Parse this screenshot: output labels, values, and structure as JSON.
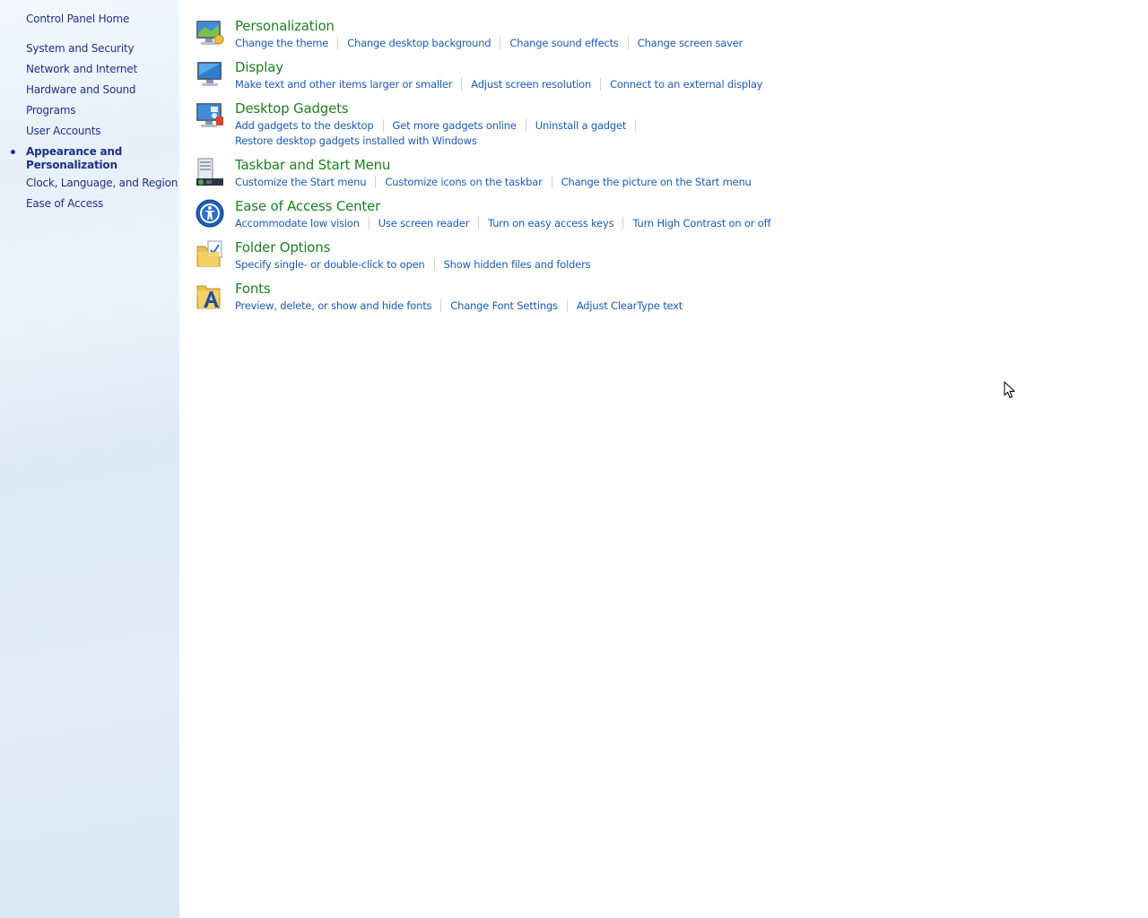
{
  "sidebar": {
    "home_label": "Control Panel Home",
    "items": [
      {
        "label": "System and Security"
      },
      {
        "label": "Network and Internet"
      },
      {
        "label": "Hardware and Sound"
      },
      {
        "label": "Programs"
      },
      {
        "label": "User Accounts"
      },
      {
        "label": "Appearance and Personalization",
        "active": true
      },
      {
        "label": "Clock, Language, and Region"
      },
      {
        "label": "Ease of Access"
      }
    ]
  },
  "categories": [
    {
      "title": "Personalization",
      "icon": "personalization-icon",
      "links": [
        "Change the theme",
        "Change desktop background",
        "Change sound effects",
        "Change screen saver"
      ]
    },
    {
      "title": "Display",
      "icon": "display-icon",
      "links": [
        "Make text and other items larger or smaller",
        "Adjust screen resolution",
        "Connect to an external display"
      ]
    },
    {
      "title": "Desktop Gadgets",
      "icon": "desktop-gadgets-icon",
      "links": [
        "Add gadgets to the desktop",
        "Get more gadgets online",
        "Uninstall a gadget",
        "Restore desktop gadgets installed with Windows"
      ]
    },
    {
      "title": "Taskbar and Start Menu",
      "icon": "taskbar-icon",
      "links": [
        "Customize the Start menu",
        "Customize icons on the taskbar",
        "Change the picture on the Start menu"
      ]
    },
    {
      "title": "Ease of Access Center",
      "icon": "ease-of-access-icon",
      "links": [
        "Accommodate low vision",
        "Use screen reader",
        "Turn on easy access keys",
        "Turn High Contrast on or off"
      ]
    },
    {
      "title": "Folder Options",
      "icon": "folder-options-icon",
      "links": [
        "Specify single- or double-click to open",
        "Show hidden files and folders"
      ]
    },
    {
      "title": "Fonts",
      "icon": "fonts-icon",
      "links": [
        "Preview, delete, or show and hide fonts",
        "Change Font Settings",
        "Adjust ClearType text"
      ]
    }
  ],
  "colors": {
    "title_green": "#1e7f20",
    "link_blue": "#1a5bb5",
    "nav_blue": "#1e3287"
  }
}
